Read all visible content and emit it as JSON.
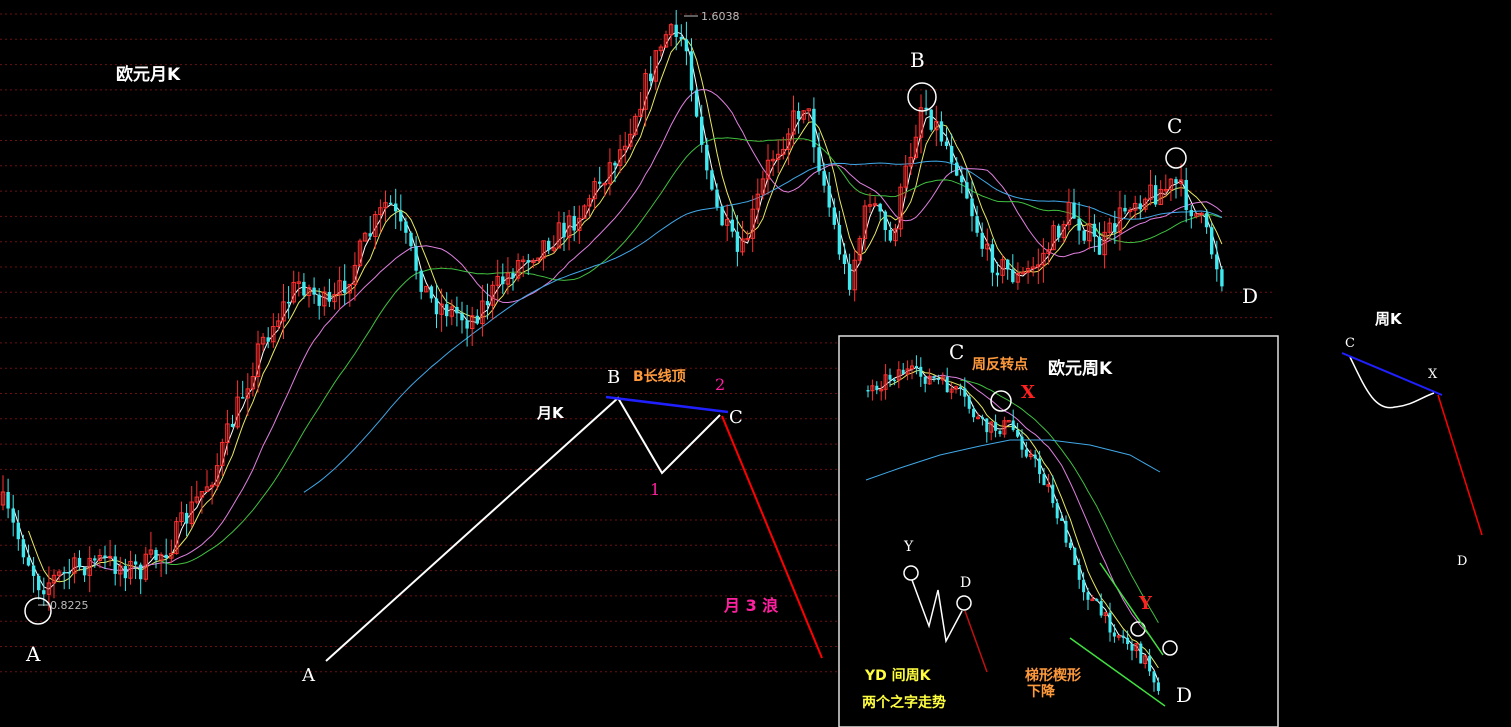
{
  "chart_data": [
    {
      "type": "candlestick",
      "title": "欧元月K",
      "annotations": {
        "high_label": "1.6038",
        "low_label": "0.8225",
        "wave_points": [
          "A",
          "B",
          "C",
          "D"
        ]
      },
      "grid": "horizontal dotted red"
    },
    {
      "type": "candlestick",
      "title": "欧元周K",
      "annotations": {
        "point_c": "C",
        "turn_label": "周反转点",
        "point_x": "X",
        "point_y": "Y",
        "point_d": "D",
        "wedge_label_1": "梯形楔形",
        "wedge_label_2": "下降"
      }
    }
  ],
  "schematic_month": {
    "label": "月K",
    "a": "A",
    "b": "B",
    "c": "C",
    "top_label": "B长线顶",
    "n1": "1",
    "n2": "2",
    "wave3_label": "月 3 浪"
  },
  "schematic_week_yd": {
    "y": "Y",
    "d": "D",
    "line1": "YD 间周K",
    "line2": "两个之字走势"
  },
  "schematic_week_right": {
    "title": "周K",
    "c": "C",
    "x": "X",
    "d": "D"
  },
  "colors": {
    "background": "#000000",
    "up_candle": "#ff3030",
    "down_candle": "#40e8f0",
    "ma_white": "#ffffff",
    "ma_yellow": "#e8e860",
    "ma_pink": "#e080e0",
    "ma_green": "#40c040",
    "ma_blue": "#40a8e8",
    "schematic_blue": "#2020ff",
    "schematic_red": "#ff0000",
    "label_orange": "#ff9a3c",
    "label_magenta": "#ff20a0",
    "label_yellow": "#ffff40",
    "label_red": "#ff2020"
  }
}
